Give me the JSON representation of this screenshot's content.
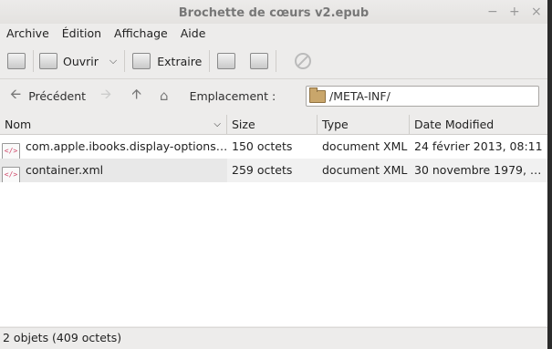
{
  "window": {
    "title": "Brochette de cœurs v2.epub"
  },
  "menu": [
    "Archive",
    "Édition",
    "Affichage",
    "Aide"
  ],
  "toolbar": {
    "open_label": "Ouvrir",
    "extract_label": "Extraire"
  },
  "location": {
    "back_label": "Précédent",
    "label": "Emplacement :",
    "path": "/META-INF/"
  },
  "columns": [
    "Nom",
    "Size",
    "Type",
    "Date Modified"
  ],
  "files": [
    {
      "name": "com.apple.ibooks.display-options…",
      "size": "150 octets",
      "type": "document XML",
      "date": "24 février 2013, 08:11"
    },
    {
      "name": "container.xml",
      "size": "259 octets",
      "type": "document XML",
      "date": "30 novembre 1979, …"
    }
  ],
  "status": "2 objets (409 octets)",
  "icons": {
    "file": "xml-file-icon",
    "window_buttons": [
      "minimize-icon",
      "maximize-icon",
      "close-icon"
    ]
  },
  "colors": {
    "xml_tag": "#d04a6b",
    "selected_row": "#e8e8e8",
    "folder": "#c9a66b"
  }
}
